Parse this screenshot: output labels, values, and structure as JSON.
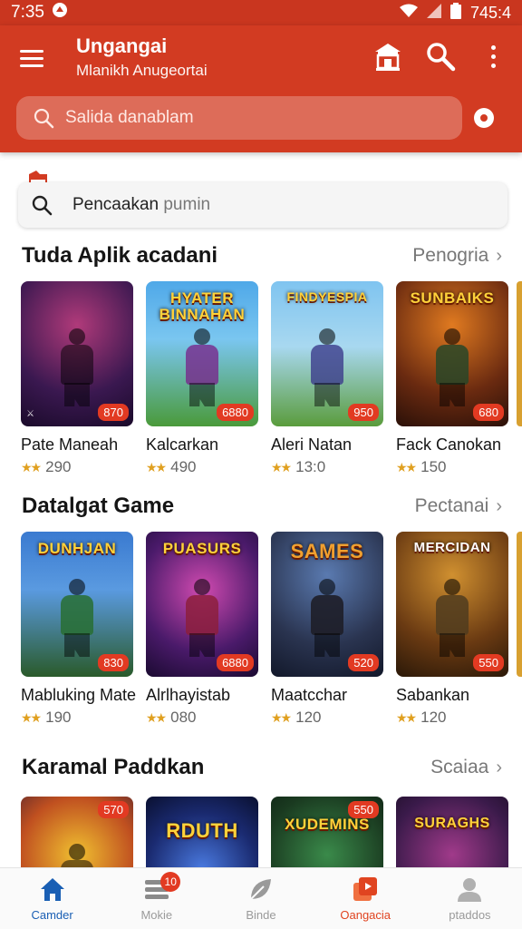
{
  "status": {
    "time": "7:35",
    "right_text": "745:4"
  },
  "header": {
    "title": "Ungangai",
    "subtitle": "Mlanikh Anugeortai",
    "search_placeholder": "Salida danablam",
    "icons": [
      "menu-icon",
      "store-icon",
      "search-icon",
      "more-vert-icon",
      "mic-icon"
    ]
  },
  "content_search": {
    "text": "Pencaakan",
    "placeholder": "pumin"
  },
  "sections": [
    {
      "title": "Tuda Aplik acadani",
      "link": "Penogria",
      "items": [
        {
          "name": "Pate Maneah",
          "rating": "290",
          "tag": "870",
          "art": ""
        },
        {
          "name": "Kalcarkan",
          "rating": "490",
          "tag": "6880",
          "art": "HYATER BINNAHAN"
        },
        {
          "name": "Aleri Natan",
          "rating": "13:0",
          "tag": "950",
          "art": "FINDYESPIA"
        },
        {
          "name": "Fack Canokan",
          "rating": "150",
          "tag": "680",
          "art": "SUNBAIKS"
        }
      ]
    },
    {
      "title": "Datalgat Game",
      "link": "Pectanai",
      "items": [
        {
          "name": "Mabluking Mate",
          "rating": "190",
          "tag": "830",
          "art": "DUNHJAN"
        },
        {
          "name": "Alrlhayistab",
          "rating": "080",
          "tag": "6880",
          "art": "PUASURS"
        },
        {
          "name": "Maatcchar",
          "rating": "120",
          "tag": "520",
          "art": "SAMES"
        },
        {
          "name": "Sabankan",
          "rating": "120",
          "tag": "550",
          "art": "MERCIDAN"
        }
      ]
    },
    {
      "title": "Karamal Paddkan",
      "link": "Scaiaa",
      "items": [
        {
          "name": "",
          "rating": "",
          "tag": "570",
          "art": ""
        },
        {
          "name": "",
          "rating": "",
          "tag": "",
          "art": "RDUTH"
        },
        {
          "name": "",
          "rating": "",
          "tag": "550",
          "art": "XUDEMINS"
        },
        {
          "name": "",
          "rating": "",
          "tag": "",
          "art": "SURAGHS"
        }
      ]
    }
  ],
  "bottom_nav": [
    {
      "label": "Camder",
      "icon": "home-icon",
      "badge": ""
    },
    {
      "label": "Mokie",
      "icon": "list-icon",
      "badge": "10"
    },
    {
      "label": "Binde",
      "icon": "leaf-icon",
      "badge": ""
    },
    {
      "label": "Oangacia",
      "icon": "video-icon",
      "badge": ""
    },
    {
      "label": "ptaddos",
      "icon": "person-icon",
      "badge": ""
    }
  ],
  "colors": {
    "primary": "#d23b22",
    "active_nav": "#1a5fb4",
    "star": "#e0a020"
  }
}
